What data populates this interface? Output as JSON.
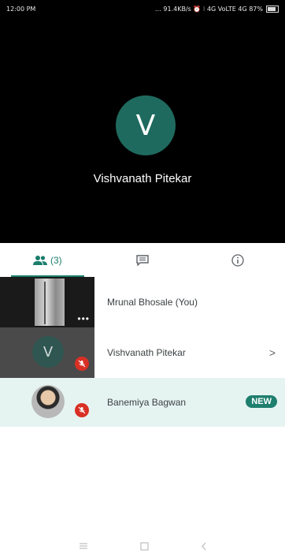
{
  "status_bar": {
    "time": "12:00 PM",
    "right": "… 91.4KB/s ⏰ ⁝ 4G VoLTE 4G 87%"
  },
  "main_stage": {
    "avatar_letter": "V",
    "name": "Vishvanath Pitekar",
    "avatar_color": "#1f6a5e"
  },
  "tabs": [
    {
      "icon": "people-icon",
      "label": "(3)",
      "active": true
    },
    {
      "icon": "chat-icon",
      "label": ""
    },
    {
      "icon": "info-icon",
      "label": ""
    }
  ],
  "participants": [
    {
      "name": "Mrunal Bhosale (You)",
      "type": "camera",
      "menu": "•••"
    },
    {
      "name": "Vishvanath Pitekar",
      "type": "avatar",
      "avatar_letter": "V",
      "muted": true,
      "chevron": ">"
    },
    {
      "name": "Banemiya Bagwan",
      "type": "photo",
      "muted": true,
      "badge": "NEW"
    }
  ],
  "accent_color": "#1a7d6c",
  "mute_color": "#d93025"
}
